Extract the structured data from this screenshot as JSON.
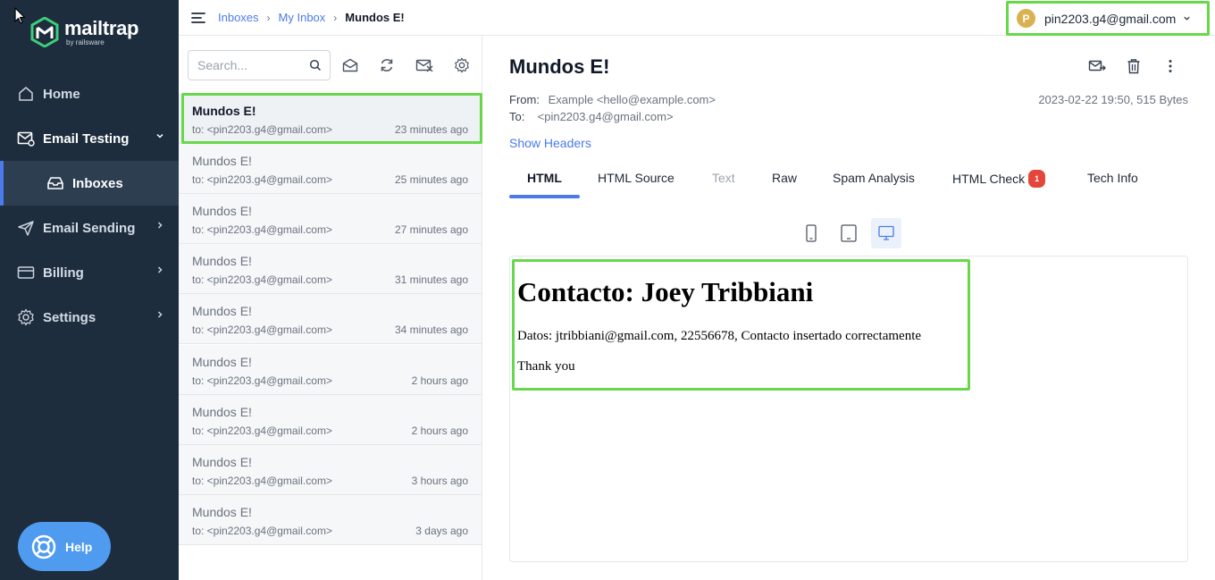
{
  "app": {
    "logo_name": "mailtrap",
    "logo_sub": "by railsware"
  },
  "sidebar": {
    "items": [
      {
        "label": "Home"
      },
      {
        "label": "Email Testing"
      },
      {
        "label": "Inboxes"
      },
      {
        "label": "Email Sending"
      },
      {
        "label": "Billing"
      },
      {
        "label": "Settings"
      }
    ],
    "help_label": "Help"
  },
  "topbar": {
    "breadcrumb": [
      "Inboxes",
      "My Inbox",
      "Mundos E!"
    ],
    "breadcrumb_sep": "›",
    "account_initial": "P",
    "account_email": "pin2203.g4@gmail.com"
  },
  "list": {
    "search_placeholder": "Search...",
    "messages": [
      {
        "subject": "Mundos E!",
        "to": "to: <pin2203.g4@gmail.com>",
        "time": "23 minutes ago"
      },
      {
        "subject": "Mundos E!",
        "to": "to: <pin2203.g4@gmail.com>",
        "time": "25 minutes ago"
      },
      {
        "subject": "Mundos E!",
        "to": "to: <pin2203.g4@gmail.com>",
        "time": "27 minutes ago"
      },
      {
        "subject": "Mundos E!",
        "to": "to: <pin2203.g4@gmail.com>",
        "time": "31 minutes ago"
      },
      {
        "subject": "Mundos E!",
        "to": "to: <pin2203.g4@gmail.com>",
        "time": "34 minutes ago"
      },
      {
        "subject": "Mundos E!",
        "to": "to: <pin2203.g4@gmail.com>",
        "time": "2 hours ago"
      },
      {
        "subject": "Mundos E!",
        "to": "to: <pin2203.g4@gmail.com>",
        "time": "2 hours ago"
      },
      {
        "subject": "Mundos E!",
        "to": "to: <pin2203.g4@gmail.com>",
        "time": "3 hours ago"
      },
      {
        "subject": "Mundos E!",
        "to": "to: <pin2203.g4@gmail.com>",
        "time": "3 days ago"
      }
    ]
  },
  "detail": {
    "subject": "Mundos E!",
    "from_label": "From:",
    "from_value": "Example <hello@example.com>",
    "to_label": "To:",
    "to_value": "<pin2203.g4@gmail.com>",
    "meta": "2023-02-22 19:50, 515 Bytes",
    "show_headers": "Show Headers",
    "tabs": [
      {
        "label": "HTML"
      },
      {
        "label": "HTML Source"
      },
      {
        "label": "Text"
      },
      {
        "label": "Raw"
      },
      {
        "label": "Spam Analysis"
      },
      {
        "label": "HTML Check",
        "badge": "1"
      },
      {
        "label": "Tech Info"
      }
    ],
    "preview": {
      "heading": "Contacto: Joey Tribbiani",
      "line1": "Datos: jtribbiani@gmail.com, 22556678, Contacto insertado correctamente",
      "line2": "Thank you"
    }
  },
  "colors": {
    "sidebar_bg": "#1e2d3d",
    "accent": "#4b7bea",
    "highlight": "#68d84a",
    "help_bg": "#4f9bf0",
    "badge": "#e4463b"
  }
}
